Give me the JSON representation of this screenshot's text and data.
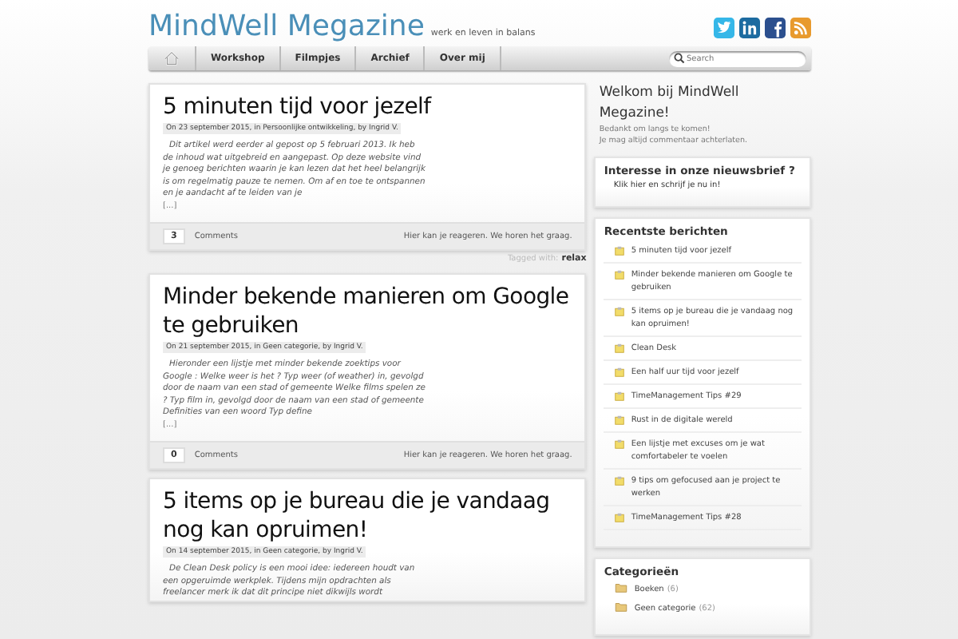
{
  "header": {
    "title": "MindWell Megazine",
    "tagline": "werk en leven in balans"
  },
  "social": [
    {
      "kind": "twitter"
    },
    {
      "kind": "linkedin"
    },
    {
      "kind": "facebook"
    },
    {
      "kind": "rss"
    }
  ],
  "nav": {
    "items": [
      {
        "label": "Workshop",
        "selected": false
      },
      {
        "label": "Filmpjes",
        "selected": false
      },
      {
        "label": "Archief",
        "selected": false
      },
      {
        "label": "Over mij",
        "selected": false
      }
    ],
    "search": {
      "placeholder": "Search"
    }
  },
  "posts": [
    {
      "title": "5 minuten tijd voor jezelf",
      "meta": "On 23 september 2015, in Persoonlijke ontwikkeling, by Ingrid V.",
      "excerpt": "Dit artikel werd eerder al gepost op 5 februari 2013. Ik heb de inhoud wat uitgebreid en aangepast.   Op deze website vind je genoeg berichten waarin je kan lezen dat het heel belangrijk is om regelmatig pauze te nemen. Om af en toe te ontspannen en je aandacht af te leiden van je",
      "more": "[...]",
      "comment_count": "3",
      "comments_label": "Comments",
      "reply_note": "Hier kan je reageren. We horen het graag.",
      "tags_label": "Tagged with:",
      "tag": "relax"
    },
    {
      "title": "Minder bekende manieren om Google te gebruiken",
      "meta": "On 21 september 2015, in Geen categorie, by Ingrid V.",
      "excerpt": "Hieronder een lijstje met minder bekende zoektips voor Google : Welke weer is het ? Typ weer (of weather) in, gevolgd door de naam van een stad of gemeente   Welke films spelen ze ? Typ film in, gevolgd door de naam van een stad of gemeente   Definities van een woord Typ define",
      "more": "[...]",
      "comment_count": "0",
      "comments_label": "Comments",
      "reply_note": "Hier kan je reageren. We horen het graag."
    },
    {
      "title": "5 items op je bureau die je vandaag nog kan opruimen!",
      "meta": "On 14 september 2015, in Geen categorie, by Ingrid V.",
      "excerpt": "De Clean Desk policy is een mooi idee: iedereen houdt van een opgeruimde werkplek. Tijdens mijn opdrachten als freelancer merk ik dat dit principe niet dikwijls wordt"
    }
  ],
  "sidebar": {
    "welcome": {
      "title": "Welkom bij MindWell Megazine!",
      "lines": [
        "Bedankt om langs te komen!",
        "Je mag altijd commentaar achterlaten."
      ]
    },
    "newsletter": {
      "title": "Interesse in onze nieuwsbrief ?",
      "text": "Klik hier en schrijf je nu in!"
    },
    "recent": {
      "title": "Recentste berichten",
      "items": [
        "5 minuten tijd voor jezelf",
        "Minder bekende manieren om Google te gebruiken",
        "5 items op je bureau die je vandaag nog kan opruimen!",
        "Clean Desk",
        "Een half uur tijd voor jezelf",
        "TimeManagement Tips #29",
        "Rust in de digitale wereld",
        "Een lijstje met excuses om je wat comfortabeler te voelen",
        "9 tips om gefocused aan je project te werken",
        "TimeManagement Tips #28"
      ]
    },
    "categories": {
      "title": "Categorieën",
      "items": [
        {
          "name": "Boeken",
          "count": "(6)"
        },
        {
          "name": "Geen categorie",
          "count": "(62)"
        }
      ]
    }
  }
}
